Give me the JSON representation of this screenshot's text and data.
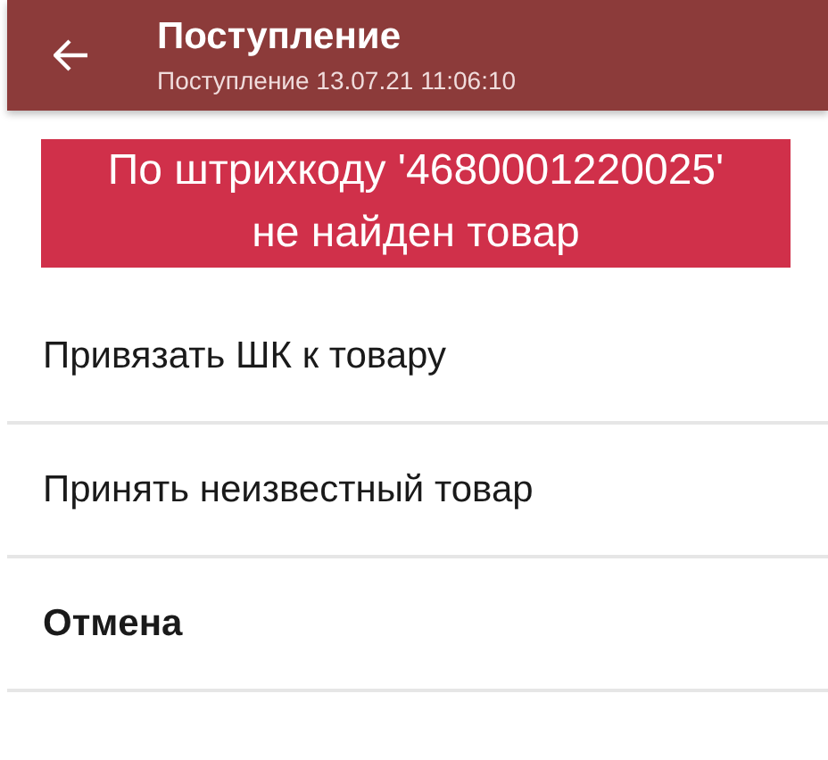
{
  "header": {
    "title": "Поступление",
    "subtitle": "Поступление 13.07.21 11:06:10"
  },
  "alert": {
    "message": "По штрихкоду '4680001220025' не найден товар"
  },
  "actions": [
    {
      "label": "Привязать ШК к товару",
      "kind": "normal"
    },
    {
      "label": "Принять неизвестный товар",
      "kind": "normal"
    },
    {
      "label": "Отмена",
      "kind": "cancel"
    }
  ]
}
